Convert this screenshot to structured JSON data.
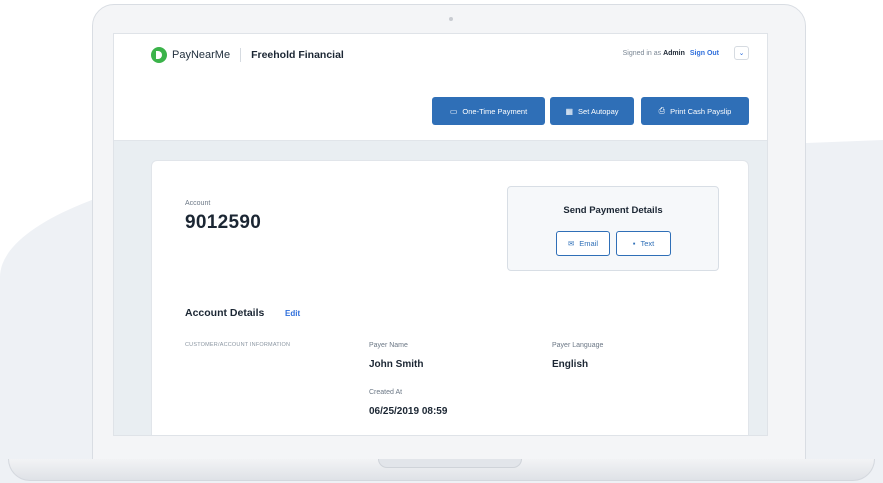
{
  "header": {
    "brand": "PayNearMe",
    "company": "Freehold Financial",
    "signed_in_prefix": "Signed in as",
    "signed_in_user": "Admin",
    "sign_out": "Sign Out",
    "dropdown_icon": "chevron-down-icon"
  },
  "actions": {
    "one_time_payment": "One-Time Payment",
    "set_autopay": "Set Autopay",
    "print_cash_payslip": "Print Cash Payslip"
  },
  "account": {
    "label": "Account",
    "number": "9012590"
  },
  "send_payment": {
    "title": "Send Payment Details",
    "email": "Email",
    "text": "Text"
  },
  "details": {
    "title": "Account Details",
    "edit": "Edit",
    "section_label": "CUSTOMER/ACCOUNT INFORMATION",
    "fields": [
      {
        "label": "Payer Name",
        "value": "John Smith"
      },
      {
        "label": "Payer Language",
        "value": "English"
      },
      {
        "label": "Created At",
        "value": "06/25/2019 08:59"
      }
    ]
  },
  "colors": {
    "primary": "#2f6fb7",
    "link": "#2f6fdc",
    "brand_green": "#3bb34a"
  }
}
